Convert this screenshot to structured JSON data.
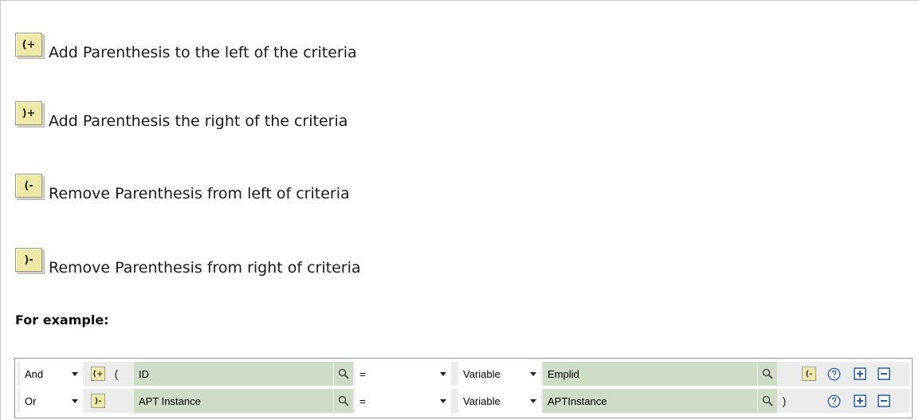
{
  "legend": [
    {
      "icon": "add-left-paren-icon",
      "button_text": "(+",
      "text": "Add Parenthesis to the left of the criteria"
    },
    {
      "icon": "add-right-paren-icon",
      "button_text": ")+",
      "text": "Add Parenthesis the right of the criteria"
    },
    {
      "icon": "remove-left-paren-icon",
      "button_text": "(-",
      "text": "Remove Parenthesis from left of criteria"
    },
    {
      "icon": "remove-right-paren-icon",
      "button_text": ")-",
      "text": "Remove Parenthesis from right of criteria"
    }
  ],
  "example_heading": "For example:",
  "criteria": [
    {
      "logical": "And",
      "paren_button": "(+",
      "left_paren": "(",
      "field": "ID",
      "operator": "=",
      "value_type": "Variable",
      "value": "Emplid",
      "right_paren": "",
      "remove_button": "(-"
    },
    {
      "logical": "Or",
      "paren_button": ")-",
      "left_paren": "",
      "field": "APT Instance",
      "operator": "=",
      "value_type": "Variable",
      "value": "APTInstance",
      "right_paren": ")",
      "remove_button": ""
    }
  ],
  "colors": {
    "button_yellow": "#efe9a8",
    "row_green": "#cfdcc8",
    "row_gray": "#ececec",
    "icon_blue": "#2a5db0"
  }
}
